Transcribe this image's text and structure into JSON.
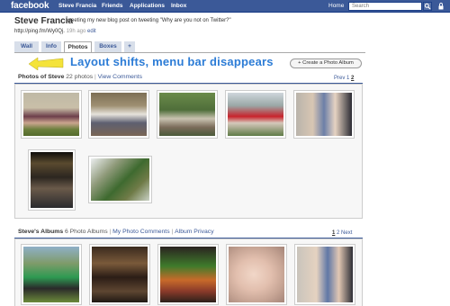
{
  "topbar": {
    "logo": "facebook",
    "nav": [
      "Steve Francia",
      "Friends",
      "Applications",
      "Inbox"
    ],
    "home": "Home",
    "search_placeholder": "Search"
  },
  "profile": {
    "name": "Steve Francia",
    "status": "tweeting my new blog post on tweeting \"Why are you not on Twitter?\"",
    "url": "http://ping.fm/Wy0Qj.",
    "time": "19h ago",
    "edit": "edit"
  },
  "tabs": [
    "Wall",
    "Info",
    "Photos",
    "Boxes",
    "+"
  ],
  "annotation": "Layout shifts, menu bar disappears",
  "create_album": "+ Create a Photo Album",
  "photos_section": {
    "title": "Photos of Steve",
    "count": "22 photos",
    "sep": "|",
    "view_comments": "View Comments",
    "pager_prev": "Prev",
    "pager_pages": [
      "1",
      "2"
    ]
  },
  "albums_section": {
    "title": "Steve's Albums",
    "count": "6 Photo Albums",
    "sep1": "|",
    "my_comments": "My Photo Comments",
    "sep2": "|",
    "privacy": "Album Privacy",
    "pager_pages": [
      "1",
      "2"
    ],
    "pager_next": "Next"
  },
  "colors": {
    "brand": "#3b5998",
    "annotation": "#2c7cd6"
  }
}
